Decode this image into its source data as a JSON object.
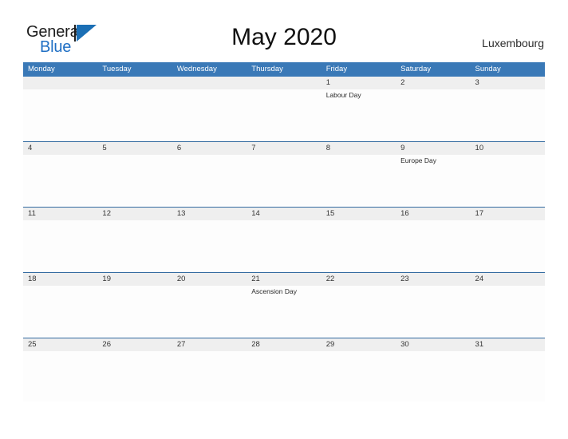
{
  "logo": {
    "word_one": "General",
    "word_two": "Blue",
    "flag_icon": "flag-triangle-icon",
    "brand_blue": "#1f6fc4",
    "flag_blue": "#1b6fb5"
  },
  "header": {
    "title": "May 2020",
    "country": "Luxembourg"
  },
  "calendar": {
    "header_bg": "#3a79b7",
    "date_band_bg": "#efefef",
    "row_divider": "#31699f",
    "day_names": [
      "Monday",
      "Tuesday",
      "Wednesday",
      "Thursday",
      "Friday",
      "Saturday",
      "Sunday"
    ],
    "weeks": [
      {
        "days": [
          {
            "date": "",
            "events": []
          },
          {
            "date": "",
            "events": []
          },
          {
            "date": "",
            "events": []
          },
          {
            "date": "",
            "events": []
          },
          {
            "date": "1",
            "events": [
              "Labour Day"
            ]
          },
          {
            "date": "2",
            "events": []
          },
          {
            "date": "3",
            "events": []
          }
        ]
      },
      {
        "days": [
          {
            "date": "4",
            "events": []
          },
          {
            "date": "5",
            "events": []
          },
          {
            "date": "6",
            "events": []
          },
          {
            "date": "7",
            "events": []
          },
          {
            "date": "8",
            "events": []
          },
          {
            "date": "9",
            "events": [
              "Europe Day"
            ]
          },
          {
            "date": "10",
            "events": []
          }
        ]
      },
      {
        "days": [
          {
            "date": "11",
            "events": []
          },
          {
            "date": "12",
            "events": []
          },
          {
            "date": "13",
            "events": []
          },
          {
            "date": "14",
            "events": []
          },
          {
            "date": "15",
            "events": []
          },
          {
            "date": "16",
            "events": []
          },
          {
            "date": "17",
            "events": []
          }
        ]
      },
      {
        "days": [
          {
            "date": "18",
            "events": []
          },
          {
            "date": "19",
            "events": []
          },
          {
            "date": "20",
            "events": []
          },
          {
            "date": "21",
            "events": [
              "Ascension Day"
            ]
          },
          {
            "date": "22",
            "events": []
          },
          {
            "date": "23",
            "events": []
          },
          {
            "date": "24",
            "events": []
          }
        ]
      },
      {
        "days": [
          {
            "date": "25",
            "events": []
          },
          {
            "date": "26",
            "events": []
          },
          {
            "date": "27",
            "events": []
          },
          {
            "date": "28",
            "events": []
          },
          {
            "date": "29",
            "events": []
          },
          {
            "date": "30",
            "events": []
          },
          {
            "date": "31",
            "events": []
          }
        ]
      }
    ]
  }
}
